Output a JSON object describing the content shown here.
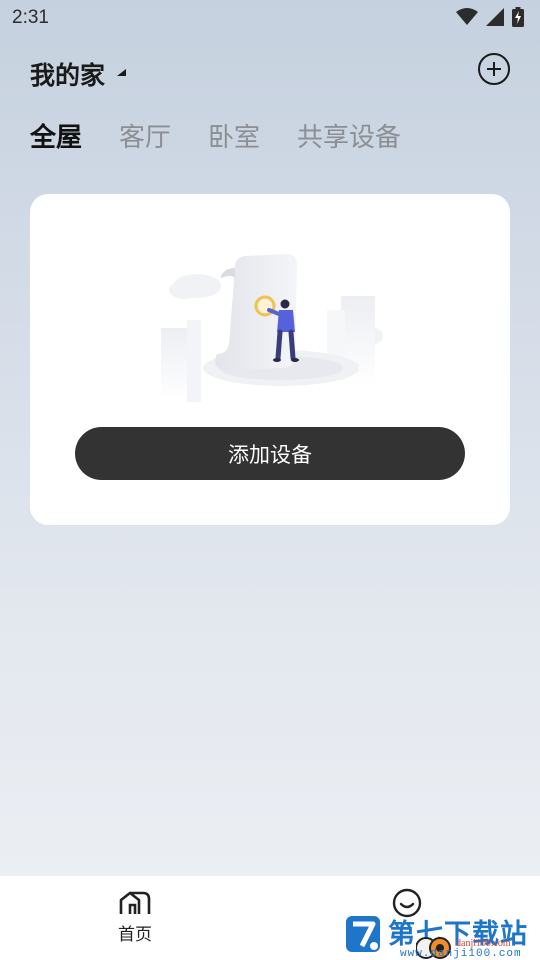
{
  "status_bar": {
    "time": "2:31",
    "icons": [
      "wifi-icon",
      "cellular-signal-icon",
      "battery-charging-icon"
    ]
  },
  "header": {
    "home_name": "我的家",
    "dropdown_icon": "caret-icon",
    "add_icon": "add-circle-icon"
  },
  "rooms": {
    "tabs": [
      {
        "label": "全屋",
        "active": true
      },
      {
        "label": "客厅",
        "active": false
      },
      {
        "label": "卧室",
        "active": false
      },
      {
        "label": "共享设备",
        "active": false
      }
    ]
  },
  "device_card": {
    "illustration": "empty-devices-illustration",
    "add_device_label": "添加设备"
  },
  "bottom_nav": {
    "items": [
      {
        "label": "首页",
        "icon": "home-icon"
      },
      {
        "label": "",
        "icon": "profile-face-icon"
      }
    ]
  },
  "watermark": {
    "brand": "第七下载站",
    "url_small": "danji100.com",
    "url": "www.danji100.com"
  },
  "colors": {
    "button_bg": "#333333",
    "tab_inactive": "#8b8e93",
    "watermark_blue": "#1f76c9",
    "watermark_red": "#d0453a"
  }
}
